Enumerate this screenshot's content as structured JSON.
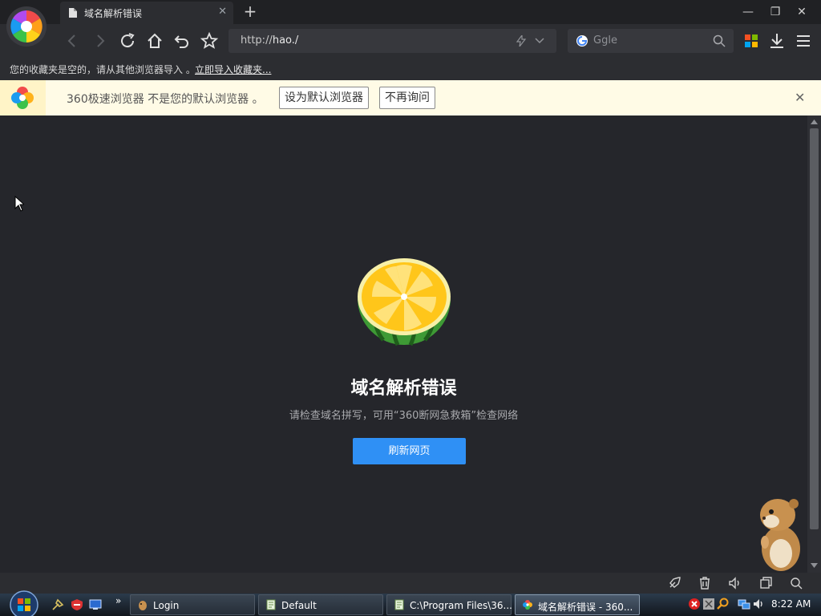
{
  "tab": {
    "title": "域名解析错误"
  },
  "addressbar": {
    "url_prefix": "http://",
    "url_host": "hao./"
  },
  "searchbox": {
    "placeholder": "Ggle"
  },
  "bookmarks_bar": {
    "message": "您的收藏夹是空的，请从其他浏览器导入 。",
    "import_link": "立即导入收藏夹..."
  },
  "infobar": {
    "message": "360极速浏览器 不是您的默认浏览器 。",
    "set_default_button": "设为默认浏览器",
    "never_ask_button": "不再询问"
  },
  "error_page": {
    "title": "域名解析错误",
    "description": "请检查域名拼写，可用“360断网急救箱”检查网络",
    "refresh_button": "刷新网页"
  },
  "taskbar": {
    "items": [
      {
        "label": "Login",
        "icon": "hamster-icon"
      },
      {
        "label": "Default",
        "icon": "notepad-icon"
      },
      {
        "label": "C:\\Program Files\\36...",
        "icon": "notepad-icon"
      },
      {
        "label": "域名解析错误 - 360...",
        "icon": "browser-360-icon"
      }
    ],
    "overflow": "»",
    "clock": "8:22 AM"
  },
  "colors": {
    "accent_button": "#2f90f5",
    "infobar_bg": "#fffbe6",
    "page_bg": "#25262b"
  }
}
